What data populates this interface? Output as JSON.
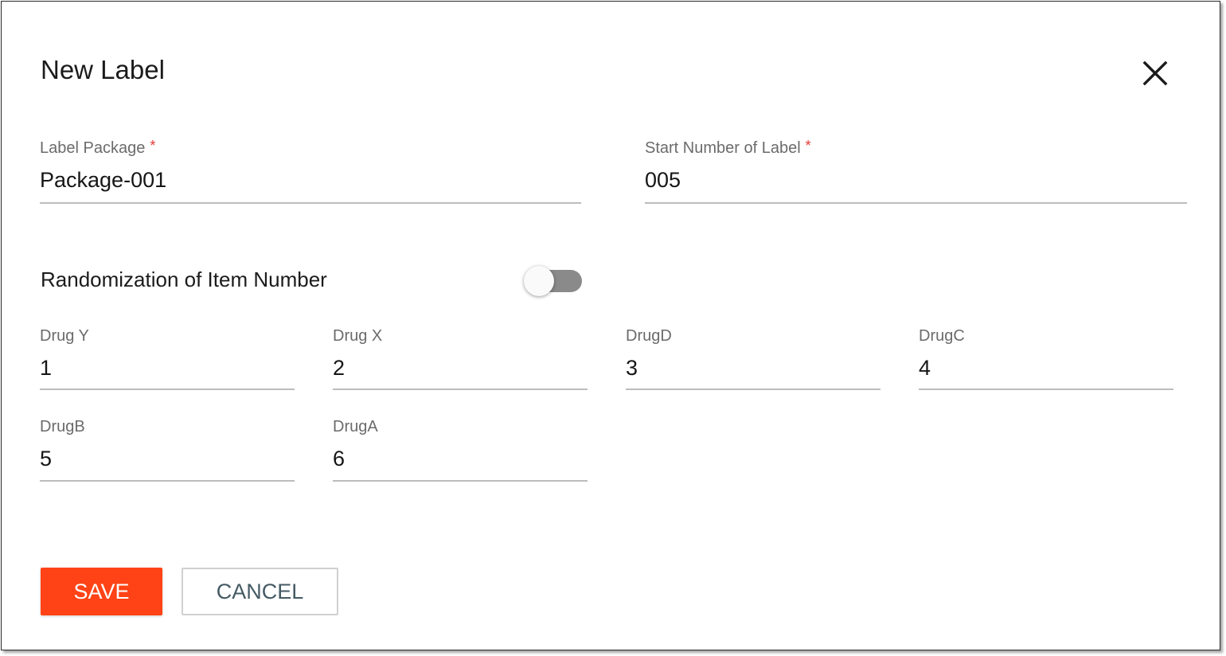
{
  "dialog": {
    "title": "New Label"
  },
  "form": {
    "label_package": {
      "label": "Label Package",
      "required_mark": "*",
      "value": "Package-001"
    },
    "start_number": {
      "label": "Start Number of Label",
      "required_mark": "*",
      "value": "005"
    },
    "randomization": {
      "label": "Randomization of Item Number",
      "enabled": false
    },
    "drugs": [
      {
        "label": "Drug Y",
        "value": "1"
      },
      {
        "label": "Drug X",
        "value": "2"
      },
      {
        "label": "DrugD",
        "value": "3"
      },
      {
        "label": "DrugC",
        "value": "4"
      },
      {
        "label": "DrugB",
        "value": "5"
      },
      {
        "label": "DrugA",
        "value": "6"
      }
    ]
  },
  "actions": {
    "save_label": "SAVE",
    "cancel_label": "CANCEL"
  },
  "colors": {
    "save_button": "#ff4316",
    "required_mark": "#e53935",
    "cancel_text": "#455a64",
    "toggle_track_off": "#8a8a8a"
  },
  "icons": {
    "close": "close-icon"
  }
}
